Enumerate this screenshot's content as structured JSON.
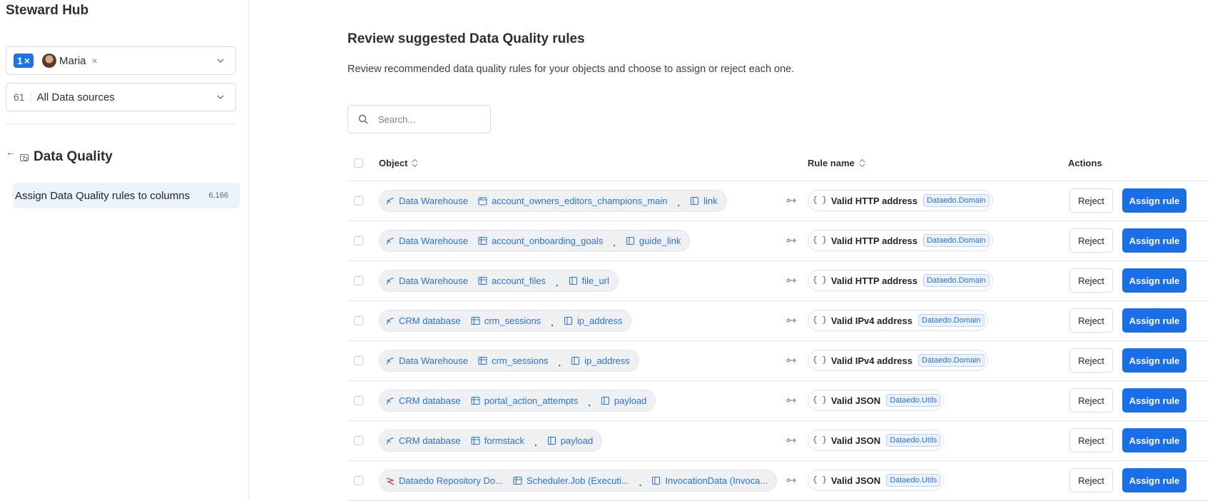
{
  "sidebar": {
    "app_title": "Steward Hub",
    "owner_filter": {
      "count": "1",
      "clear_symbol": "×",
      "user_name": "Maria"
    },
    "source_filter": {
      "count": "61",
      "label": "All Data sources"
    },
    "section_title": "Data Quality",
    "item": {
      "label": "Assign Data Quality rules to columns",
      "count": "6,166"
    }
  },
  "main": {
    "title": "Review suggested Data Quality rules",
    "description": "Review recommended data quality rules for your objects and choose to assign or reject each one.",
    "search_placeholder": "Search...",
    "columns": {
      "object": "Object",
      "rule_name": "Rule name",
      "actions": "Actions"
    },
    "rows": [
      {
        "source": "Data Warehouse",
        "source_icon": "database-icon",
        "table": "account_owners_editors_champions_main",
        "table_icon": "view-icon",
        "column": "link",
        "rule": "Valid HTTP address",
        "library": "Dataedo.Domain",
        "reject": "Reject",
        "assign": "Assign rule"
      },
      {
        "source": "Data Warehouse",
        "source_icon": "database-icon",
        "table": "account_onboarding_goals",
        "table_icon": "table-icon",
        "column": "guide_link",
        "rule": "Valid HTTP address",
        "library": "Dataedo.Domain",
        "reject": "Reject",
        "assign": "Assign rule"
      },
      {
        "source": "Data Warehouse",
        "source_icon": "database-icon",
        "table": "account_files",
        "table_icon": "table-icon",
        "column": "file_url",
        "rule": "Valid HTTP address",
        "library": "Dataedo.Domain",
        "reject": "Reject",
        "assign": "Assign rule"
      },
      {
        "source": "CRM database",
        "source_icon": "database-icon",
        "table": "crm_sessions",
        "table_icon": "table-icon",
        "column": "ip_address",
        "rule": "Valid IPv4 address",
        "library": "Dataedo.Domain",
        "reject": "Reject",
        "assign": "Assign rule"
      },
      {
        "source": "Data Warehouse",
        "source_icon": "database-icon",
        "table": "crm_sessions",
        "table_icon": "table-icon",
        "column": "ip_address",
        "rule": "Valid IPv4 address",
        "library": "Dataedo.Domain",
        "reject": "Reject",
        "assign": "Assign rule"
      },
      {
        "source": "CRM database",
        "source_icon": "database-icon",
        "table": "portal_action_attempts",
        "table_icon": "table-icon",
        "column": "payload",
        "rule": "Valid JSON",
        "library": "Dataedo.Utils",
        "reject": "Reject",
        "assign": "Assign rule"
      },
      {
        "source": "CRM database",
        "source_icon": "database-icon",
        "table": "formstack",
        "table_icon": "table-icon",
        "column": "payload",
        "rule": "Valid JSON",
        "library": "Dataedo.Utils",
        "reject": "Reject",
        "assign": "Assign rule"
      },
      {
        "source": "Dataedo Repository Do...",
        "source_icon": "sqlserver-icon",
        "table": "Scheduler.Job (Executi...",
        "table_icon": "table-icon",
        "column": "InvocationData (Invoca...",
        "rule": "Valid JSON",
        "library": "Dataedo.Utils",
        "reject": "Reject",
        "assign": "Assign rule"
      }
    ]
  },
  "colors": {
    "accent": "#1a6fe8",
    "link": "#2d72d2",
    "selected_bg": "#edf3fc",
    "border": "#e3e5e8"
  }
}
